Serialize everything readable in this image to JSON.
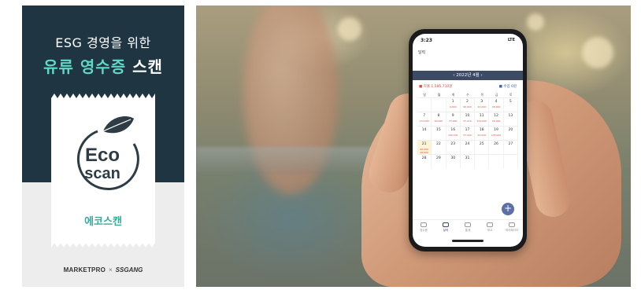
{
  "promo": {
    "headline_line1": "ESG 경영을 위한",
    "headline_line2_part1": "유류 영수증",
    "headline_line2_part2": "스캔",
    "logo_line1": "Eco",
    "logo_line2": "scan",
    "brand_name": "에코스캔",
    "partner1": "MARKETPRO",
    "separator": "×",
    "partner2": "SSGANG",
    "colors": {
      "panel": "#1f3542",
      "accent": "#5fd8c8",
      "logo": "#2e3c45",
      "brand_text": "#3aa89b"
    }
  },
  "phone": {
    "status_time": "3:23",
    "status_indicators": "LTE",
    "app_title": "달력",
    "month_label": "‹  2022년 4월  ›",
    "expense_summary": "■ 지출  1,585,710원",
    "income_summary": "■ 수입  0원",
    "weekdays": [
      "일",
      "월",
      "화",
      "수",
      "목",
      "금",
      "토"
    ],
    "weeks": [
      [
        {
          "d": ""
        },
        {
          "d": ""
        },
        {
          "d": "1",
          "a": "9,000"
        },
        {
          "d": "2",
          "a": "90,000"
        },
        {
          "d": "3",
          "a": "43,000"
        },
        {
          "d": "4",
          "a": "48,000"
        },
        {
          "d": "5"
        }
      ],
      [
        {
          "d": "7",
          "a": "172,000"
        },
        {
          "d": "8",
          "a": "90,000"
        },
        {
          "d": "9",
          "a": "73,000"
        },
        {
          "d": "10",
          "a": "57,210"
        },
        {
          "d": "11",
          "a": "171,000"
        },
        {
          "d": "12",
          "a": "36,000"
        },
        {
          "d": "13"
        }
      ],
      [
        {
          "d": "14"
        },
        {
          "d": "15"
        },
        {
          "d": "16",
          "a": "190,700"
        },
        {
          "d": "17",
          "a": "57,000"
        },
        {
          "d": "18",
          "a": "22,000"
        },
        {
          "d": "19",
          "a": "135,000"
        },
        {
          "d": "20"
        }
      ],
      [
        {
          "d": "21",
          "a": "60,000",
          "b": "44,000"
        },
        {
          "d": "22"
        },
        {
          "d": "23"
        },
        {
          "d": "24"
        },
        {
          "d": "25"
        },
        {
          "d": "26"
        },
        {
          "d": "27"
        }
      ],
      [
        {
          "d": "28"
        },
        {
          "d": "29"
        },
        {
          "d": "30"
        },
        {
          "d": "31"
        },
        {
          "d": ""
        },
        {
          "d": ""
        },
        {
          "d": ""
        }
      ]
    ],
    "fab_label": "+",
    "tabs": [
      "영수증",
      "달력",
      "통계",
      "보고",
      "마이페이지"
    ]
  }
}
